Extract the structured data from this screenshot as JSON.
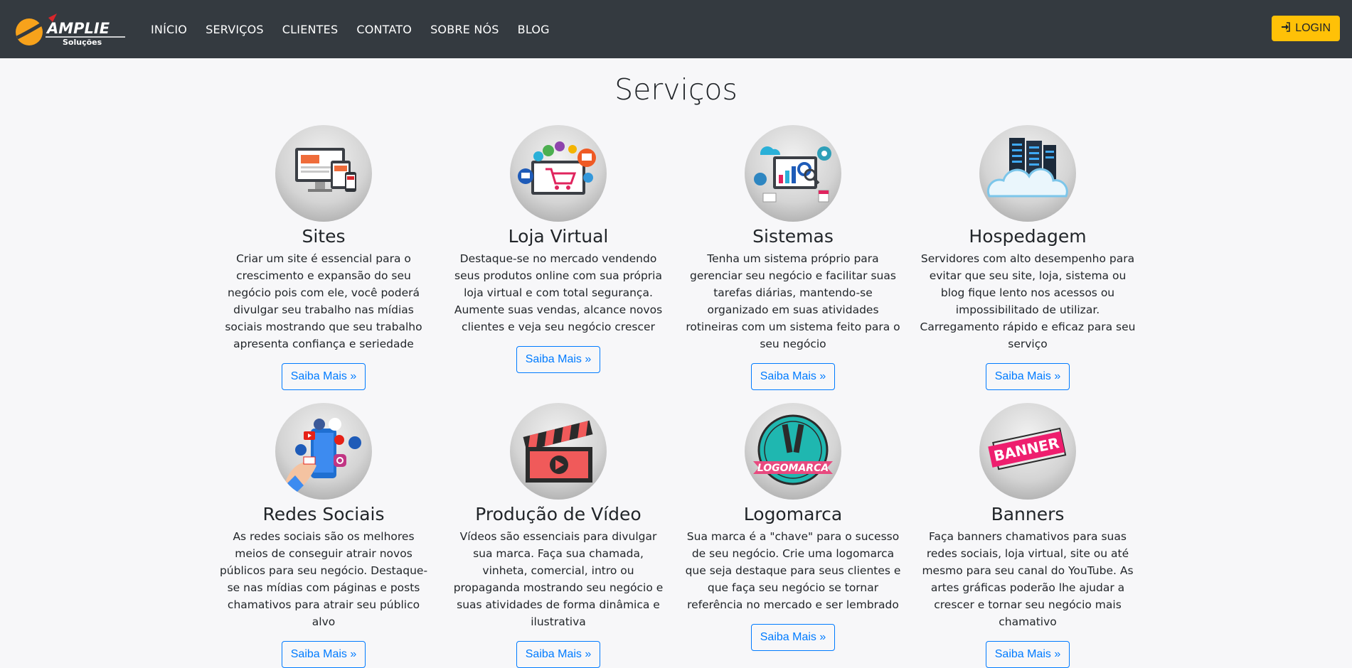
{
  "header": {
    "brand": {
      "name": "AMPLIE",
      "tagline": "Soluções"
    },
    "nav": [
      "INÍCIO",
      "SERVIÇOS",
      "CLIENTES",
      "CONTATO",
      "SOBRE NÓS",
      "BLOG"
    ],
    "login_label": "LOGIN"
  },
  "main": {
    "title": "Serviços",
    "more_label": "Saiba Mais »",
    "services": [
      {
        "title": "Sites",
        "icon": "website-devices-icon",
        "text": "Criar um site é essencial para o crescimento e expansão do seu negócio pois com ele, você poderá divulgar seu trabalho nas mídias sociais mostrando que seu trabalho apresenta confiança e seriedade"
      },
      {
        "title": "Loja Virtual",
        "icon": "shopping-cart-icon",
        "text": "Destaque-se no mercado vendendo seus produtos online com sua própria loja virtual e com total segurança. Aumente suas vendas, alcance novos clientes e veja seu negócio crescer"
      },
      {
        "title": "Sistemas",
        "icon": "systems-dashboard-icon",
        "text": "Tenha um sistema próprio para gerenciar seu negócio e facilitar suas tarefas diárias, mantendo-se organizado em suas atividades rotineiras com um sistema feito para o seu negócio"
      },
      {
        "title": "Hospedagem",
        "icon": "cloud-server-icon",
        "text": "Servidores com alto desempenho para evitar que seu site, loja, sistema ou blog fique lento nos acessos ou impossibilitado de utilizar. Carregamento rápido e eficaz para seu serviço"
      },
      {
        "title": "Redes Sociais",
        "icon": "social-media-phone-icon",
        "text": "As redes sociais são os melhores meios de conseguir atrair novos públicos para seu negócio. Destaque-se nas mídias com páginas e posts chamativos para atrair seu público alvo"
      },
      {
        "title": "Produção de Vídeo",
        "icon": "clapperboard-icon",
        "text": "Vídeos são essenciais para divulgar sua marca. Faça sua chamada, vinheta, comercial, intro ou propaganda mostrando seu negócio e suas atividades de forma dinâmica e ilustrativa"
      },
      {
        "title": "Logomarca",
        "icon": "logo-badge-icon",
        "badge": "LOGOMARCA",
        "text": "Sua marca é a \"chave\" para o sucesso de seu negócio. Crie uma logomarca que seja destaque para seus clientes e que faça seu negócio se tornar referência no mercado e ser lembrado"
      },
      {
        "title": "Banners",
        "icon": "banner-icon",
        "badge": "BANNER",
        "text": "Faça banners chamativos para suas redes sociais, loja virtual, site ou até mesmo para seu canal do YouTube. As artes gráficas poderão lhe ajudar a crescer e tornar seu negócio mais chamativo"
      }
    ]
  },
  "colors": {
    "navbar": "#343a40",
    "login": "#ffc107",
    "link": "#007bff",
    "brand_orange": "#f7a21b"
  }
}
